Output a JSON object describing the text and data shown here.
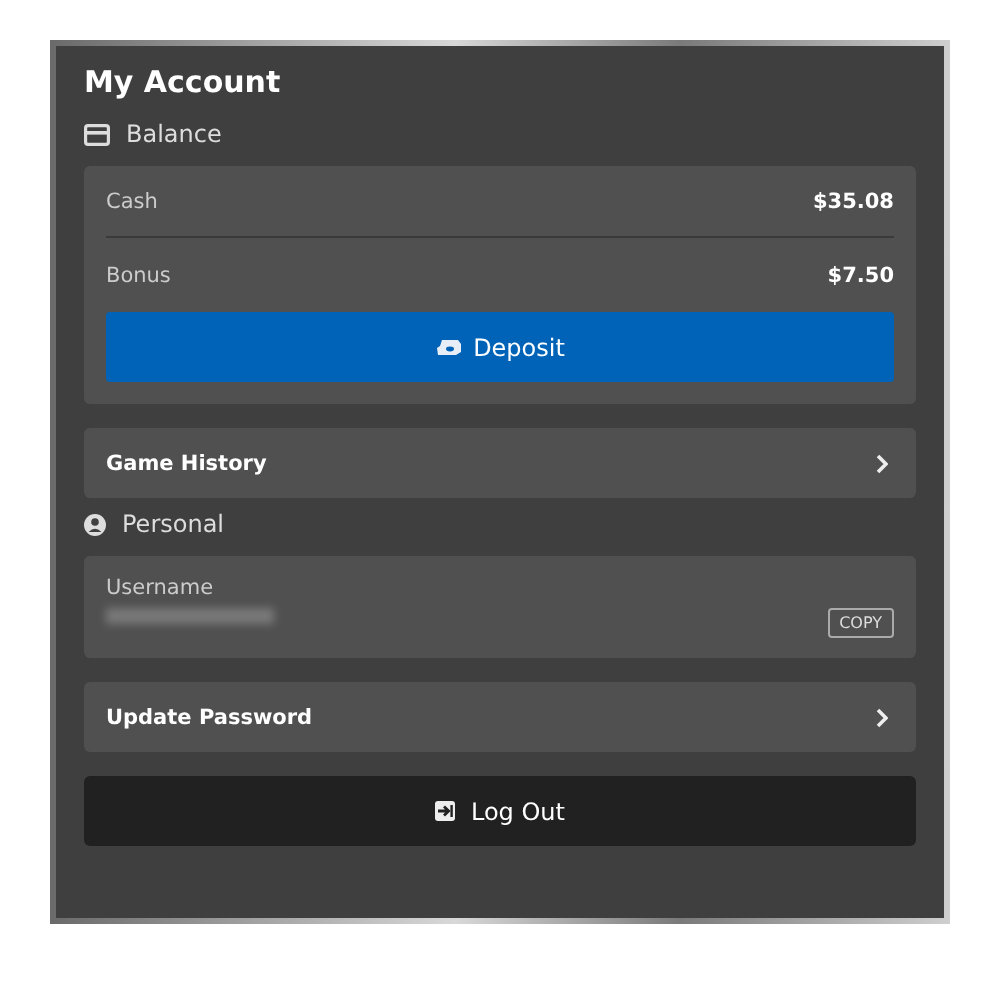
{
  "title": "My Account",
  "balance": {
    "heading": "Balance",
    "rows": [
      {
        "label": "Cash",
        "value": "$35.08"
      },
      {
        "label": "Bonus",
        "value": "$7.50"
      }
    ],
    "deposit_button": "Deposit"
  },
  "game_history": "Game History",
  "personal": {
    "heading": "Personal",
    "username": {
      "label": "Username",
      "copy_button": "COPY"
    }
  },
  "update_password": "Update Password",
  "logout_button": "Log Out"
}
